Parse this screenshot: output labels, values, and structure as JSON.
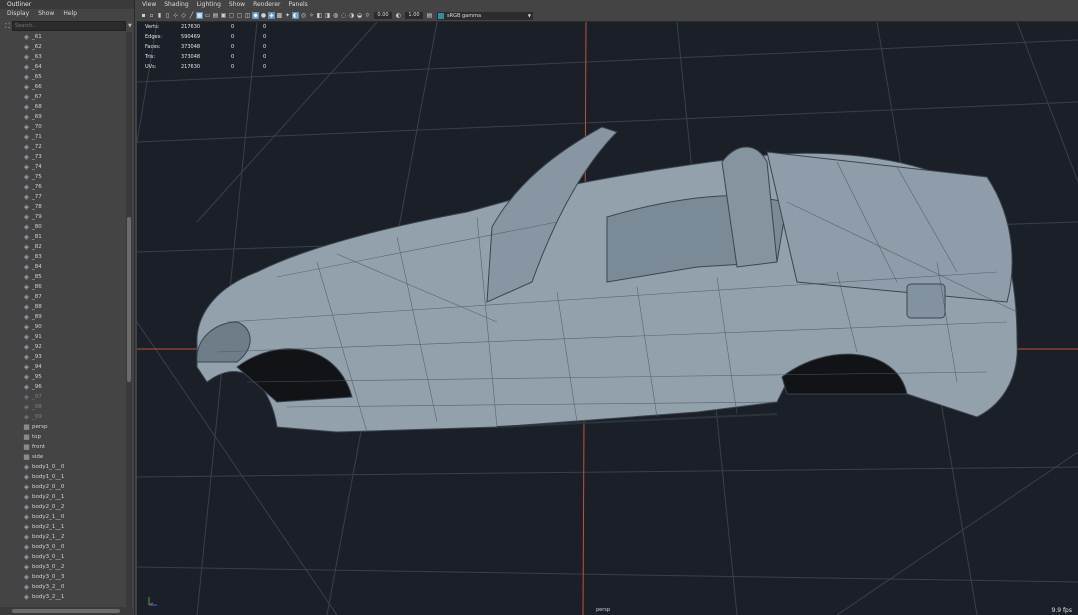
{
  "outliner": {
    "title": "Outliner",
    "menu": [
      "Display",
      "Show",
      "Help"
    ],
    "search_placeholder": "Search...",
    "items": [
      {
        "label": "_61",
        "type": "mesh"
      },
      {
        "label": "_62",
        "type": "mesh"
      },
      {
        "label": "_63",
        "type": "mesh"
      },
      {
        "label": "_64",
        "type": "mesh"
      },
      {
        "label": "_65",
        "type": "mesh"
      },
      {
        "label": "_66",
        "type": "mesh"
      },
      {
        "label": "_67",
        "type": "mesh"
      },
      {
        "label": "_68",
        "type": "mesh"
      },
      {
        "label": "_69",
        "type": "mesh"
      },
      {
        "label": "_70",
        "type": "mesh"
      },
      {
        "label": "_71",
        "type": "mesh"
      },
      {
        "label": "_72",
        "type": "mesh"
      },
      {
        "label": "_73",
        "type": "mesh"
      },
      {
        "label": "_74",
        "type": "mesh"
      },
      {
        "label": "_75",
        "type": "mesh"
      },
      {
        "label": "_76",
        "type": "mesh"
      },
      {
        "label": "_77",
        "type": "mesh"
      },
      {
        "label": "_78",
        "type": "mesh"
      },
      {
        "label": "_79",
        "type": "mesh"
      },
      {
        "label": "_80",
        "type": "mesh"
      },
      {
        "label": "_81",
        "type": "mesh"
      },
      {
        "label": "_82",
        "type": "mesh"
      },
      {
        "label": "_83",
        "type": "mesh"
      },
      {
        "label": "_84",
        "type": "mesh"
      },
      {
        "label": "_85",
        "type": "mesh"
      },
      {
        "label": "_86",
        "type": "mesh"
      },
      {
        "label": "_87",
        "type": "mesh"
      },
      {
        "label": "_88",
        "type": "mesh"
      },
      {
        "label": "_89",
        "type": "mesh"
      },
      {
        "label": "_90",
        "type": "mesh"
      },
      {
        "label": "_91",
        "type": "mesh"
      },
      {
        "label": "_92",
        "type": "mesh"
      },
      {
        "label": "_93",
        "type": "mesh"
      },
      {
        "label": "_94",
        "type": "mesh"
      },
      {
        "label": "_95",
        "type": "mesh"
      },
      {
        "label": "_96",
        "type": "mesh"
      },
      {
        "label": "_97",
        "type": "mesh-dim"
      },
      {
        "label": "_98",
        "type": "mesh-dim"
      },
      {
        "label": "_99",
        "type": "mesh-dim"
      },
      {
        "label": "persp",
        "type": "camera"
      },
      {
        "label": "top",
        "type": "camera"
      },
      {
        "label": "front",
        "type": "camera"
      },
      {
        "label": "side",
        "type": "camera"
      },
      {
        "label": "body1_0__0",
        "type": "mesh"
      },
      {
        "label": "body1_0__1",
        "type": "mesh"
      },
      {
        "label": "body2_0__0",
        "type": "mesh"
      },
      {
        "label": "body2_0__1",
        "type": "mesh"
      },
      {
        "label": "body2_0__2",
        "type": "mesh"
      },
      {
        "label": "body2_1__0",
        "type": "mesh"
      },
      {
        "label": "body2_1__1",
        "type": "mesh"
      },
      {
        "label": "body2_1__2",
        "type": "mesh"
      },
      {
        "label": "body3_0__0",
        "type": "mesh"
      },
      {
        "label": "body3_0__1",
        "type": "mesh"
      },
      {
        "label": "body3_0__2",
        "type": "mesh"
      },
      {
        "label": "body3_0__3",
        "type": "mesh"
      },
      {
        "label": "body3_2__0",
        "type": "mesh"
      },
      {
        "label": "body3_2__1",
        "type": "mesh"
      }
    ]
  },
  "viewport": {
    "menu": [
      "View",
      "Shading",
      "Lighting",
      "Show",
      "Renderer",
      "Panels"
    ],
    "exposure": "0.00",
    "gamma": "1.00",
    "color_space": "sRGB gamma",
    "hud": [
      {
        "label": "Verts:",
        "v1": "217630",
        "v2": "0",
        "v3": "0"
      },
      {
        "label": "Edges:",
        "v1": "590469",
        "v2": "0",
        "v3": "0"
      },
      {
        "label": "Faces:",
        "v1": "373048",
        "v2": "0",
        "v3": "0"
      },
      {
        "label": "Tris:",
        "v1": "373048",
        "v2": "0",
        "v3": "0"
      },
      {
        "label": "UVs:",
        "v1": "217630",
        "v2": "0",
        "v3": "0"
      }
    ],
    "camera_label": "persp",
    "fps": "9.9 fps",
    "colors": {
      "background": "#1b1f27",
      "grid": "#3a3f48",
      "axis": "#c2523a",
      "mesh_fill": "#93a1ad",
      "wire": "#3b4550"
    }
  }
}
